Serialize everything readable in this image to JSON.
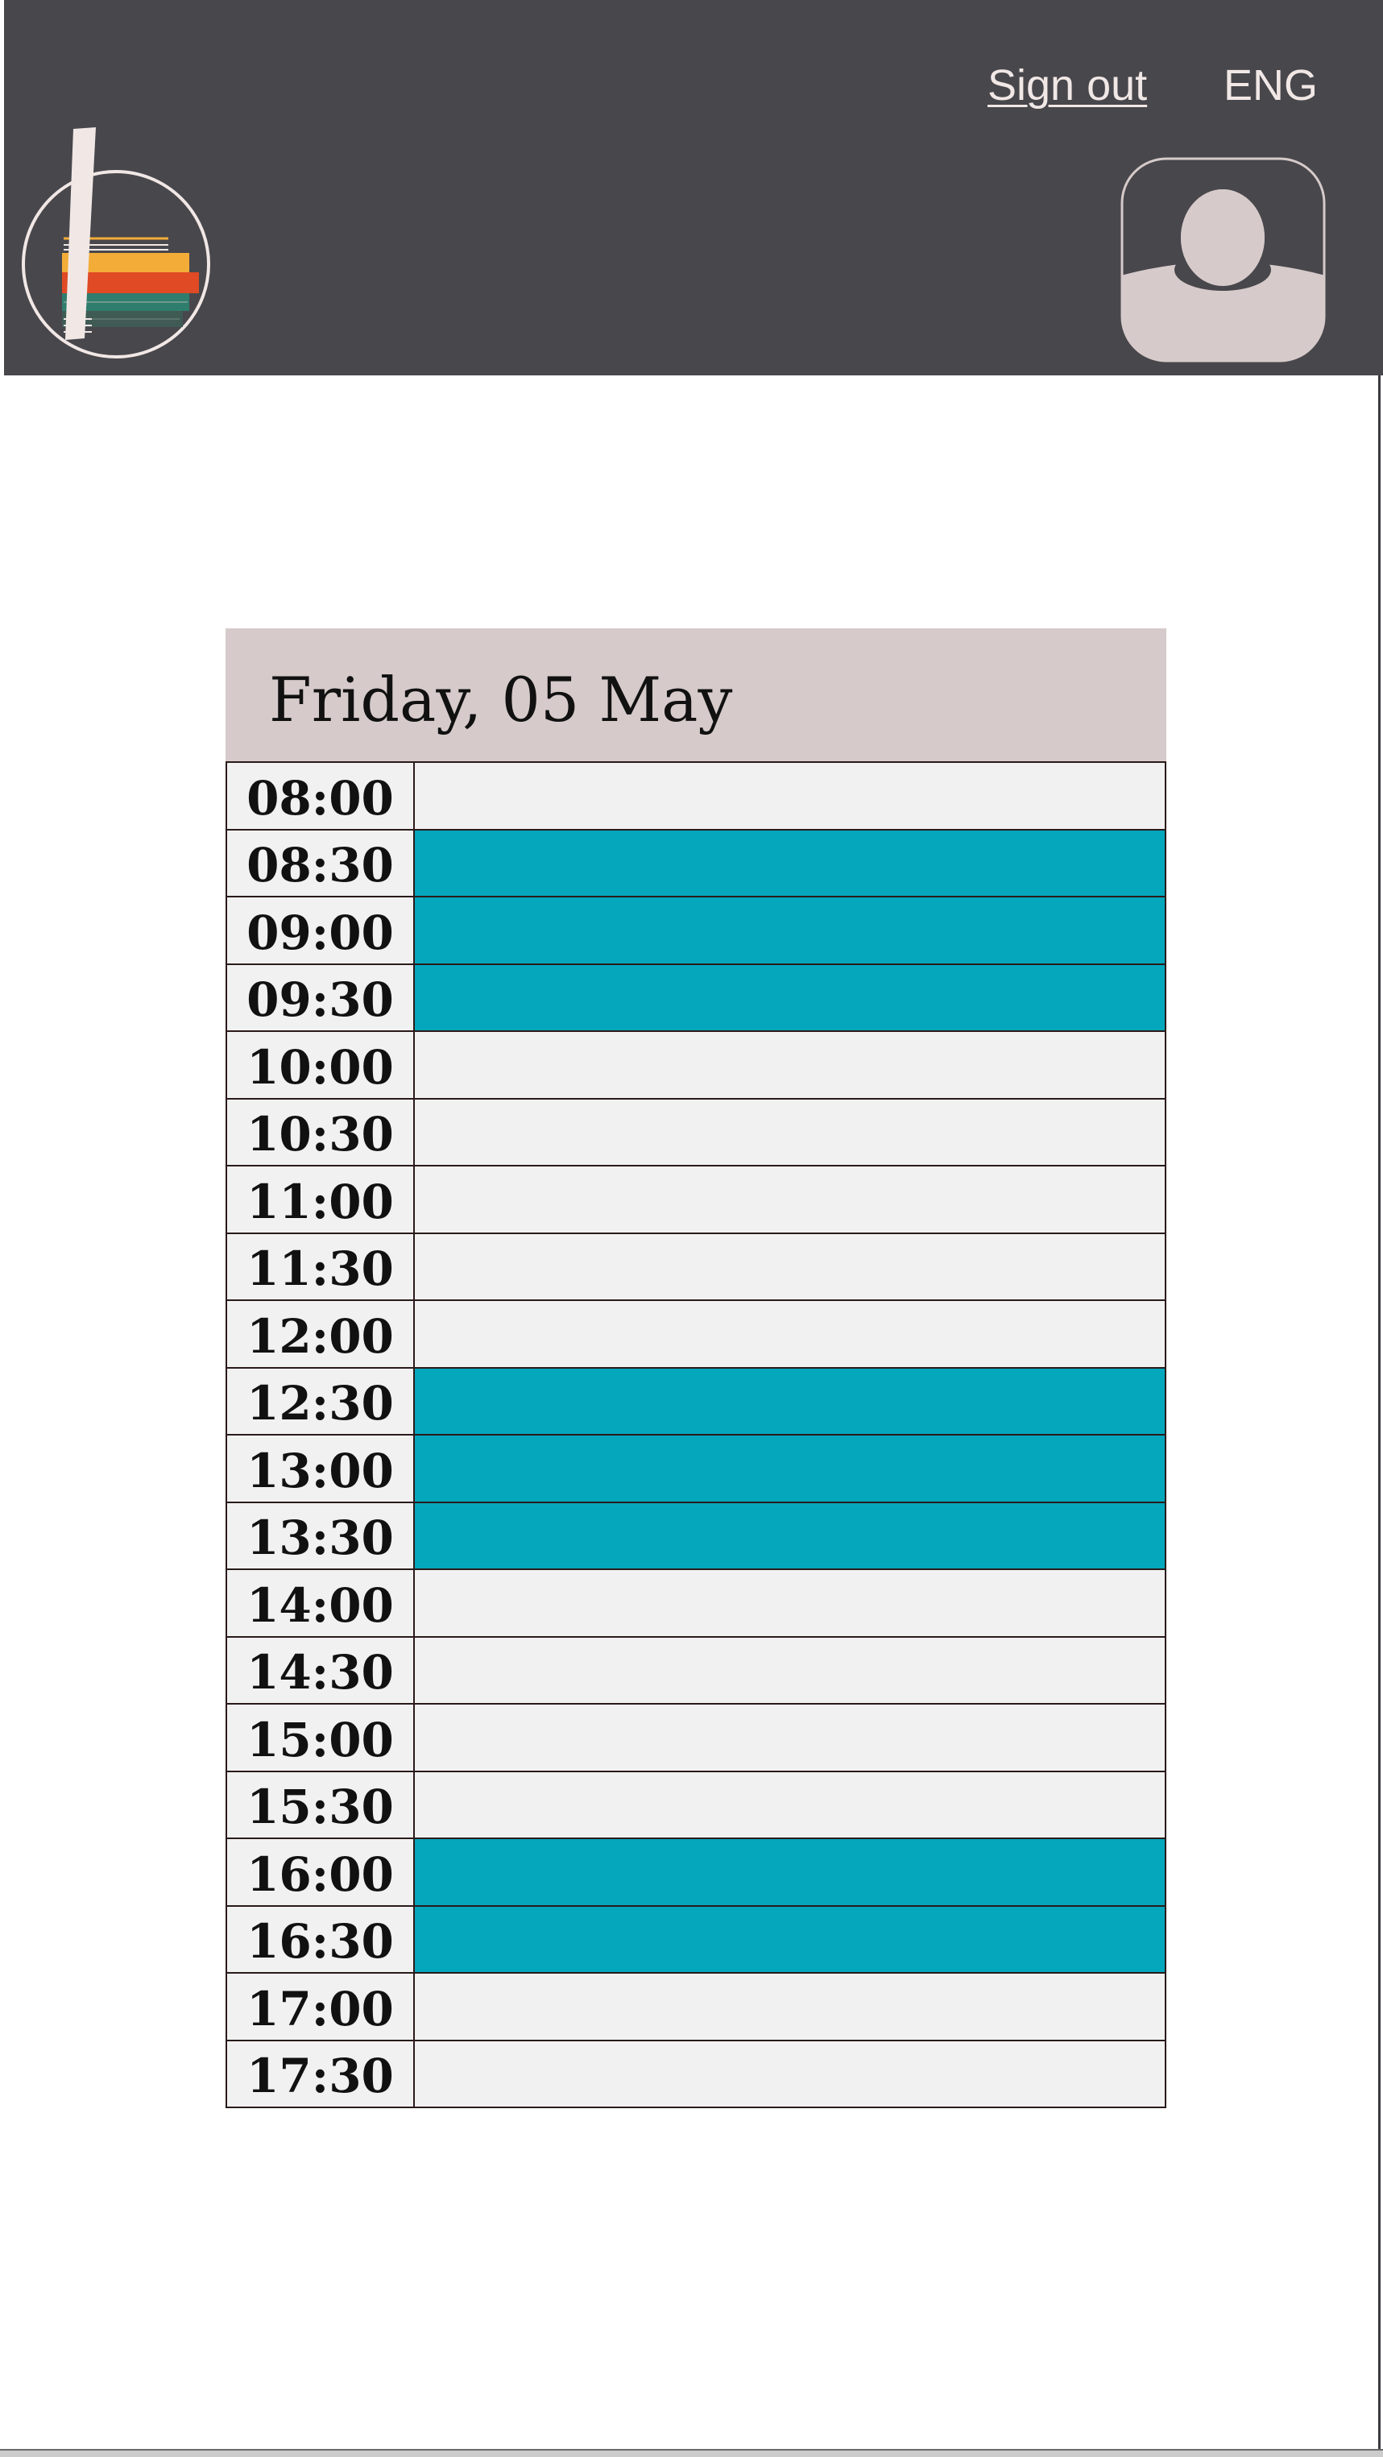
{
  "header": {
    "sign_out": "Sign out",
    "language": "ENG",
    "background": "#48474c",
    "text_color": "#f1e8e6"
  },
  "logo": {
    "icon": "bookshelf-logo-icon"
  },
  "avatar": {
    "icon": "user-avatar-icon"
  },
  "schedule": {
    "date_title": "Friday, 05 May",
    "booked_color": "#05a7bc",
    "free_color": "#f2f1f1",
    "slots": [
      {
        "time": "08:00",
        "booked": false
      },
      {
        "time": "08:30",
        "booked": true
      },
      {
        "time": "09:00",
        "booked": true
      },
      {
        "time": "09:30",
        "booked": true
      },
      {
        "time": "10:00",
        "booked": false
      },
      {
        "time": "10:30",
        "booked": false
      },
      {
        "time": "11:00",
        "booked": false
      },
      {
        "time": "11:30",
        "booked": false
      },
      {
        "time": "12:00",
        "booked": false
      },
      {
        "time": "12:30",
        "booked": true
      },
      {
        "time": "13:00",
        "booked": true
      },
      {
        "time": "13:30",
        "booked": true
      },
      {
        "time": "14:00",
        "booked": false
      },
      {
        "time": "14:30",
        "booked": false
      },
      {
        "time": "15:00",
        "booked": false
      },
      {
        "time": "15:30",
        "booked": false
      },
      {
        "time": "16:00",
        "booked": true
      },
      {
        "time": "16:30",
        "booked": true
      },
      {
        "time": "17:00",
        "booked": false
      },
      {
        "time": "17:30",
        "booked": false
      }
    ]
  }
}
